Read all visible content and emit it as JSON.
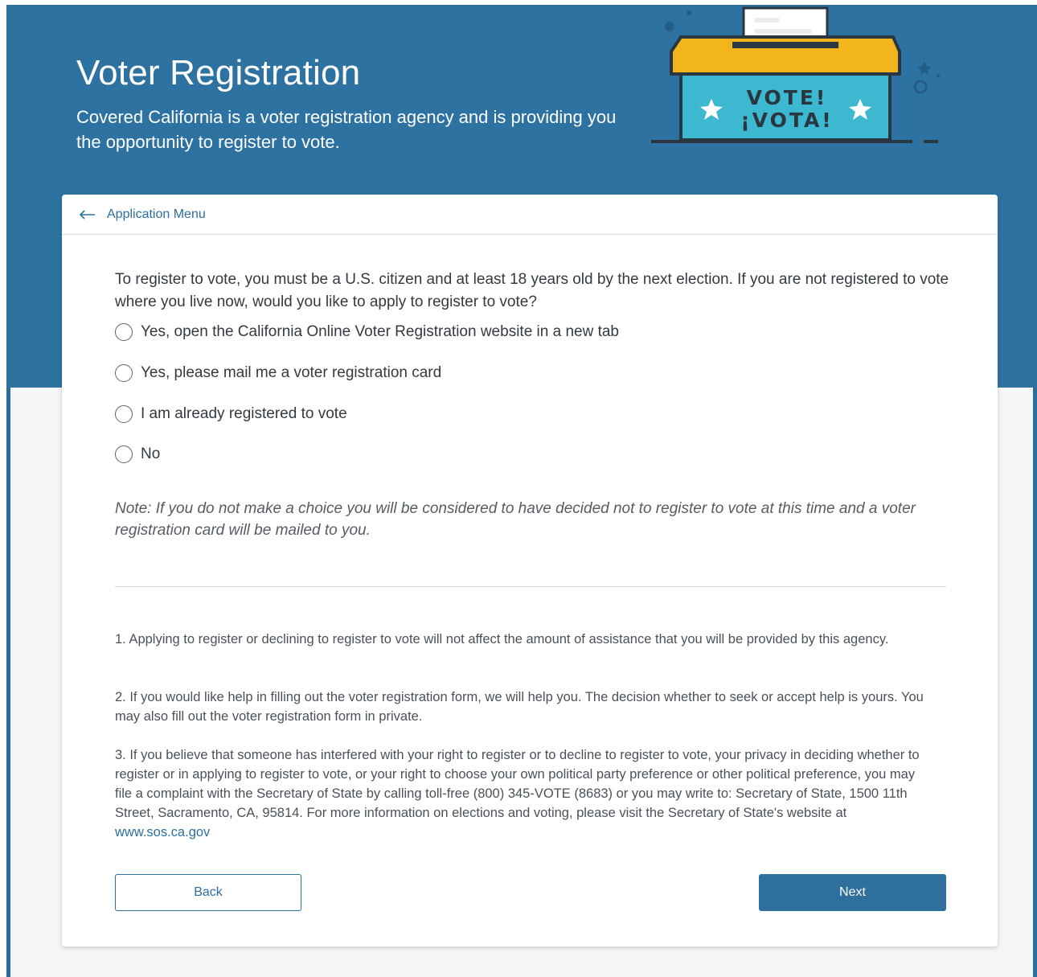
{
  "header": {
    "title": "Voter Registration",
    "subtitle": "Covered California is a voter registration agency and is providing you the opportunity to register to vote.",
    "ballot_box": {
      "line1": "VOTE!",
      "line2": "¡VOTA!"
    }
  },
  "card": {
    "back_link": "Application Menu",
    "question": "To register to vote, you must be a U.S. citizen and at least 18 years old by the next election. If you are not registered to vote where you live now, would you like to apply to register to vote?",
    "options": [
      {
        "label": "Yes, open the California Online Voter Registration website in a new tab"
      },
      {
        "label": "Yes, please mail me a voter registration card"
      },
      {
        "label": "I am already registered to vote"
      },
      {
        "label": "No"
      }
    ],
    "note": "Note: If you do not make a choice you will be considered to have decided not to register to vote at this time and a voter registration card will be mailed to you.",
    "disclaimers": {
      "item1": "1. Applying to register or declining to register to vote will not affect the amount of assistance that you will be provided by this agency.",
      "item2": "2. If you would like help in filling out the voter registration form, we will help you. The decision whether to seek or accept help is yours. You may also fill out the voter registration form in private.",
      "item3_text": "3. If you believe that someone has interfered with your right to register or to decline to register to vote, your privacy in deciding whether to register or in applying to register to vote, or your right to choose your own political party preference or other political preference, you may file a complaint with the Secretary of State by calling toll-free (800) 345-VOTE (8683) or you may write to: Secretary of State, 1500 11th Street, Sacramento, CA, 95814. For more information on elections and voting, please visit the Secretary of State's website at ",
      "item3_link": "www.sos.ca.gov"
    },
    "buttons": {
      "back": "Back",
      "next": "Next"
    }
  },
  "colors": {
    "header_bg": "#2e72a2",
    "accent": "#2e6f9e",
    "ballot_teal": "#3cb8d0",
    "ballot_lid": "#f2b51b"
  }
}
